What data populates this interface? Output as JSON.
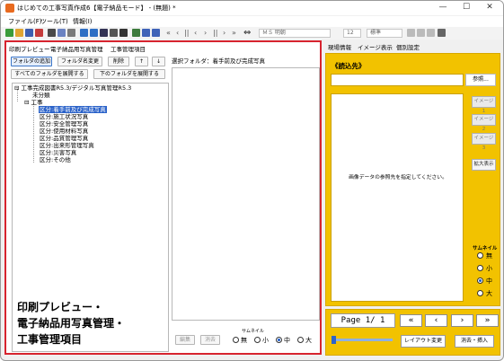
{
  "window": {
    "title": "はじめての工事写真作成6【電子納品モード】 - (無題)  *",
    "minimize_label": "—",
    "maximize_label": "☐",
    "close_label": "✕"
  },
  "menu": {
    "items": [
      "ファイル(F)",
      "ツール(T)",
      "情報(I)"
    ]
  },
  "toolbar": {
    "font_name": "ＭＳ 明朝",
    "font_size": "12",
    "style": "標準",
    "nav_glyphs": [
      "«",
      "‹",
      "||",
      "‹",
      "›",
      "||",
      "›",
      "»",
      "⇔"
    ]
  },
  "left_tabs": [
    "印刷プレビュー",
    "電子納品用写真管理",
    "工事管理項目"
  ],
  "folder_buttons": {
    "add_folder": "フォルダの追加",
    "rename_folder": "フォルダ名変更",
    "delete": "削除",
    "move_up": "↑",
    "move_down": "↓",
    "expand_all": "すべてのフォルダを展開する",
    "expand_below": "下のフォルダを展開する"
  },
  "tree": {
    "root": "工事完成図書R5.3/デジタル写真管理R5.3",
    "nodes": [
      "未分類",
      "工事",
      "区分:着手前及び完成写真",
      "区分:施工状況写真",
      "区分:安全管理写真",
      "区分:使用材料写真",
      "区分:品質管理写真",
      "区分:出来形管理写真",
      "区分:災害写真",
      "区分:その他"
    ]
  },
  "folder_panel": {
    "selected_label": "選択フォルダ：着手前及び完成写真"
  },
  "bottom": {
    "edit": "編集",
    "erase": "消去",
    "thumbnail_label": "サムネイル",
    "sizes": [
      "無",
      "小",
      "中",
      "大"
    ],
    "selected_size": "中"
  },
  "callout": {
    "lines": [
      "印刷プレビュー・",
      "電子納品用写真管理・",
      "工事管理項目"
    ]
  },
  "right_tabs": [
    "現場情報",
    "イメージ表示",
    "個別設定"
  ],
  "image_panel": {
    "heading": "《読込先》",
    "browse": "参照...",
    "message": "画像データの参照先を指定してください。",
    "image_buttons": [
      "イメージ1",
      "イメージ2",
      "イメージ3"
    ],
    "zoom": "拡大表示",
    "thumbnail_label": "サムネイル",
    "sizes": [
      "無",
      "小",
      "中",
      "大"
    ],
    "selected_size": "中"
  },
  "nav_panel": {
    "page_text": "Page 1/ 1",
    "first": "«",
    "prev": "‹",
    "next": "›",
    "last": "»",
    "layout_change": "レイアウト変更",
    "delete_insert": "消去・挿入"
  },
  "colors": {
    "highlight_red": "#d7242f",
    "panel_yellow": "#f2c200",
    "selection_blue": "#2a62c9"
  }
}
